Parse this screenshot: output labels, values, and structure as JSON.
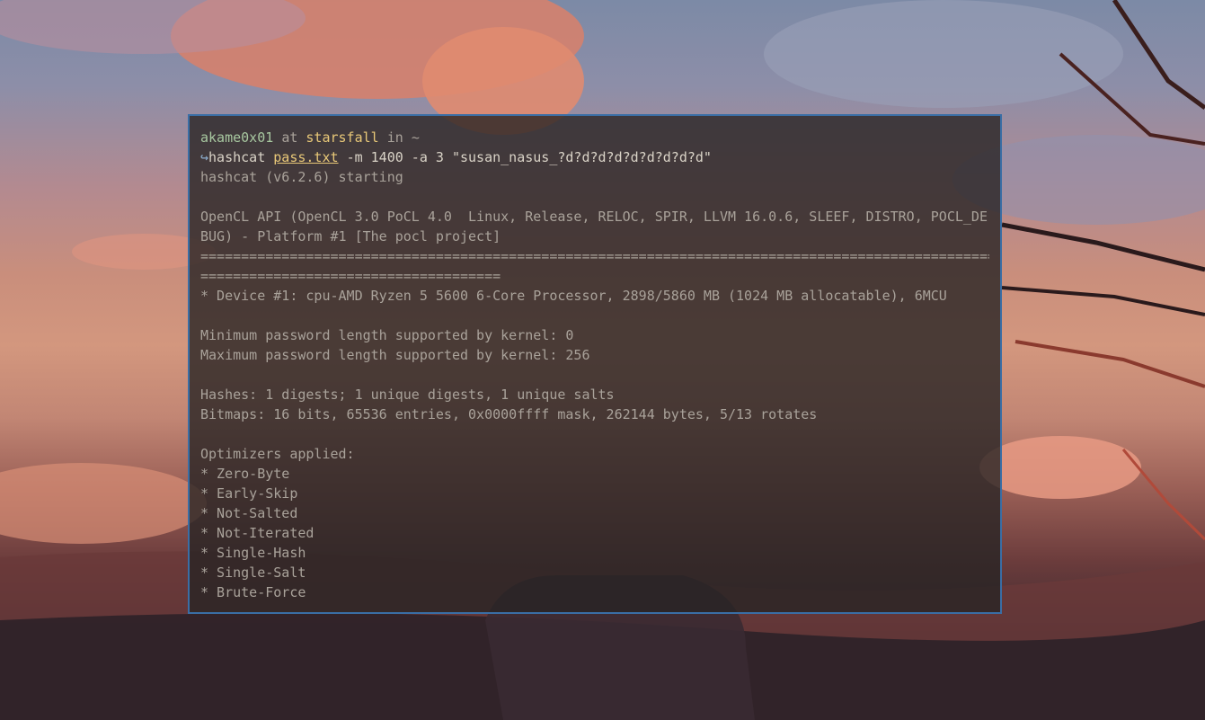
{
  "prompt": {
    "user": "akame0x01",
    "at": "at",
    "host": "starsfall",
    "in": "in",
    "dir": "~",
    "arrow": "↪",
    "command": "hashcat",
    "file_arg": "pass.txt",
    "args": "-m 1400 -a 3",
    "mask": "\"susan_nasus_?d?d?d?d?d?d?d?d?d\""
  },
  "output": {
    "starting": "hashcat (v6.2.6) starting",
    "opencl_line1": "OpenCL API (OpenCL 3.0 PoCL 4.0  Linux, Release, RELOC, SPIR, LLVM 16.0.6, SLEEF, DISTRO, POCL_DE",
    "opencl_line2": "BUG) - Platform #1 [The pocl project]",
    "separator_line1": "====================================================================================================",
    "separator_line2": "=====================================",
    "device": "* Device #1: cpu-AMD Ryzen 5 5600 6-Core Processor, 2898/5860 MB (1024 MB allocatable), 6MCU",
    "min_pw": "Minimum password length supported by kernel: 0",
    "max_pw": "Maximum password length supported by kernel: 256",
    "hashes": "Hashes: 1 digests; 1 unique digests, 1 unique salts",
    "bitmaps": "Bitmaps: 16 bits, 65536 entries, 0x0000ffff mask, 262144 bytes, 5/13 rotates",
    "optimizers_header": "Optimizers applied:",
    "optimizers": [
      "* Zero-Byte",
      "* Early-Skip",
      "* Not-Salted",
      "* Not-Iterated",
      "* Single-Hash",
      "* Single-Salt",
      "* Brute-Force"
    ]
  },
  "colors": {
    "terminal_border": "#3a6ea5",
    "user": "#a8c8a0",
    "host": "#e8c878",
    "text": "#a9a29a"
  }
}
